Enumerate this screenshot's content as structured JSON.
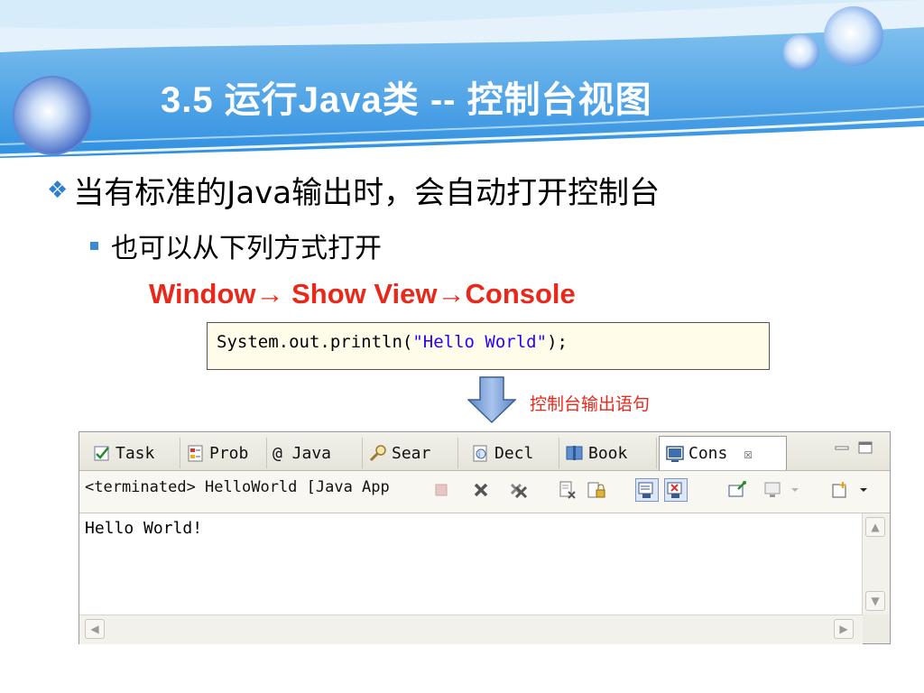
{
  "slide": {
    "title": "3.5 运行Java类 -- 控制台视图",
    "bullet_level1": "当有标准的Java输出时，会自动打开控制台",
    "bullet_level2": "也可以从下列方式打开",
    "menu_path": "Window→ Show View→Console",
    "code": {
      "prefix": "System.out.println(",
      "string": "\"Hello World\"",
      "suffix": ");"
    },
    "arrow_caption": "控制台输出语句"
  },
  "eclipse": {
    "tabs": [
      {
        "label": "Task",
        "icon": "task-icon"
      },
      {
        "label": "Prob",
        "icon": "problems-icon"
      },
      {
        "label": "@ Java",
        "icon": "javadoc-icon"
      },
      {
        "label": "Sear",
        "icon": "search-icon"
      },
      {
        "label": "Decl",
        "icon": "declaration-icon"
      },
      {
        "label": "Book",
        "icon": "bookmarks-icon"
      },
      {
        "label": "Cons",
        "icon": "console-icon",
        "active": true
      }
    ],
    "close_glyph": "☒",
    "process_label": "<terminated> HelloWorld [Java App",
    "console_output": "Hello World!"
  },
  "colors": {
    "accent_blue": "#2f7fd1",
    "emphasis_red": "#e8281a",
    "code_string": "#2a00ff"
  }
}
